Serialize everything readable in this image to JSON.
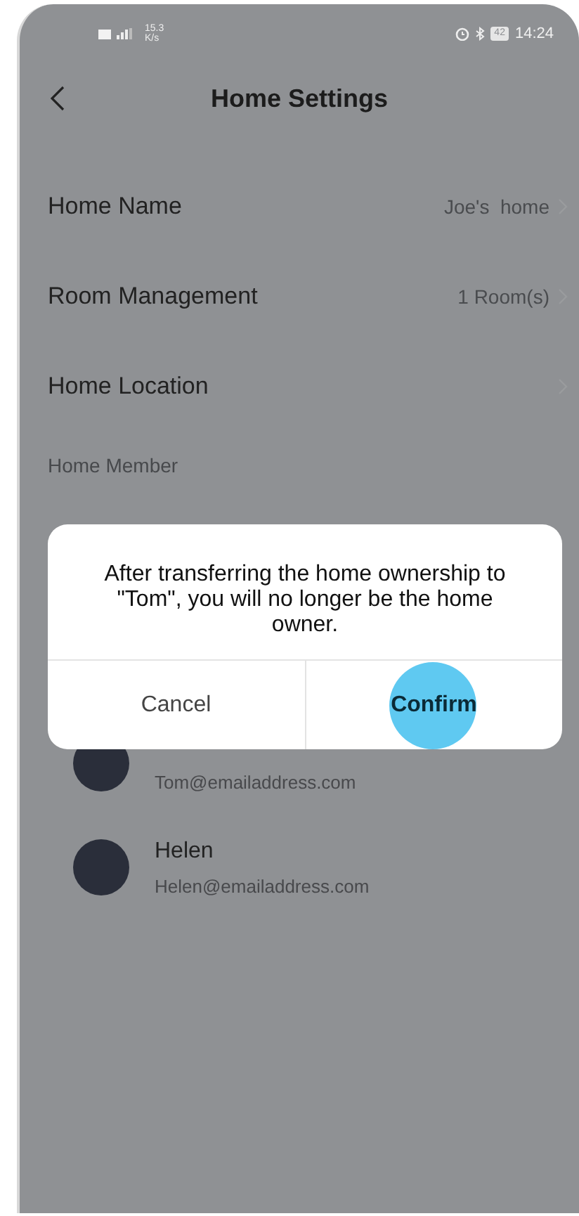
{
  "status_bar": {
    "net_speed": "15.3",
    "net_unit": "K/s",
    "battery": "42",
    "time": "14:24"
  },
  "header": {
    "title": "Home Settings"
  },
  "settings": [
    {
      "label": "Home Name",
      "value": "Joe's  home"
    },
    {
      "label": "Room Management",
      "value": "1 Room(s)"
    },
    {
      "label": "Home Location"
    }
  ],
  "section_title": "Home Member",
  "members": [
    {
      "email": "Tom@emailaddress.com"
    },
    {
      "name": "Helen",
      "email": "Helen@emailaddress.com"
    }
  ],
  "dialog": {
    "message": "After transferring the home ownership to \"Tom\", you will no longer be the home owner.",
    "buttons": [
      {
        "label": "Cancel",
        "kind": "cancel",
        "selected": false
      },
      {
        "label": "Confirm",
        "kind": "confirm",
        "selected": true
      }
    ]
  }
}
